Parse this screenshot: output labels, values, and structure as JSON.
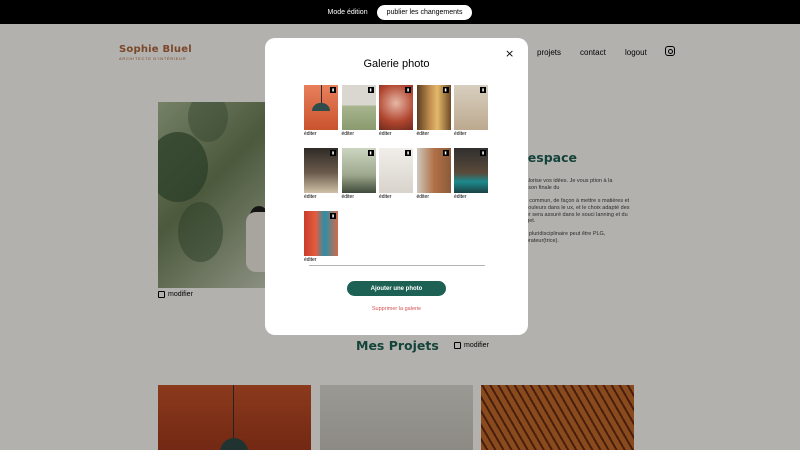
{
  "editbar": {
    "mode_label": "Mode édition",
    "publish_label": "publier les changements"
  },
  "header": {
    "logo_name": "Sophie Bluel",
    "logo_sub": "ARCHITECTE D'INTÉRIEUR",
    "nav": [
      "projets",
      "contact",
      "logout"
    ],
    "instagram_icon": "instagram-icon"
  },
  "intro": {
    "edit_label": "modifier",
    "title": "d'espace",
    "paragraphs": [
      "je valorise vos idées. Je vous ption à la livraison finale du",
      "é en commun, de façon à mettre s matières et les couleurs dans le ux, et le choix adapté des antier sera assuré dans le souci lanning et du budget.",
      "uipe pluridisciplinaire peut être PLG, décorateur(trice)."
    ]
  },
  "projects": {
    "title": "Mes Projets",
    "edit_label": "modifier"
  },
  "modal": {
    "close_label": "×",
    "title": "Galerie photo",
    "edit_caption": "éditer",
    "photos": [
      "p1",
      "p2",
      "p3",
      "p4",
      "p5",
      "p6",
      "p7",
      "p8",
      "p9",
      "p10",
      "p11"
    ],
    "add_button": "Ajouter une photo",
    "delete_link": "Supprimer la galerie"
  },
  "colors": {
    "accent": "#1d6154",
    "brand": "#b1663c",
    "danger": "#d65353"
  }
}
